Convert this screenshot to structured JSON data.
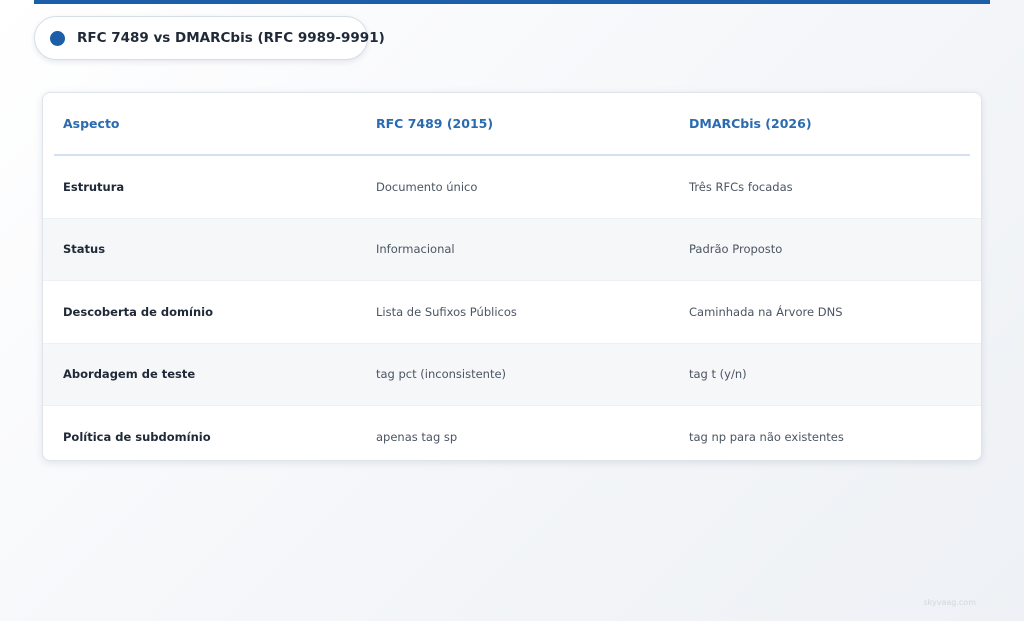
{
  "title": "RFC 7489 vs DMARCbis (RFC 9989-9991)",
  "table": {
    "headers": [
      "Aspecto",
      "RFC 7489 (2015)",
      "DMARCbis (2026)"
    ],
    "rows": [
      [
        "Estrutura",
        "Documento único",
        "Três RFCs focadas"
      ],
      [
        "Status",
        "Informacional",
        "Padrão Proposto"
      ],
      [
        "Descoberta de domínio",
        "Lista de Sufixos Públicos",
        "Caminhada na Árvore DNS"
      ],
      [
        "Abordagem de teste",
        "tag pct (inconsistente)",
        "tag t (y/n)"
      ],
      [
        "Política de subdomínio",
        "apenas tag sp",
        "tag np para não existentes"
      ]
    ]
  },
  "watermark": "skyvaag.com",
  "colors": {
    "accent": "#1c5fa8",
    "header_text": "#2a6bb0",
    "alt_row": "#f6f7f9"
  }
}
